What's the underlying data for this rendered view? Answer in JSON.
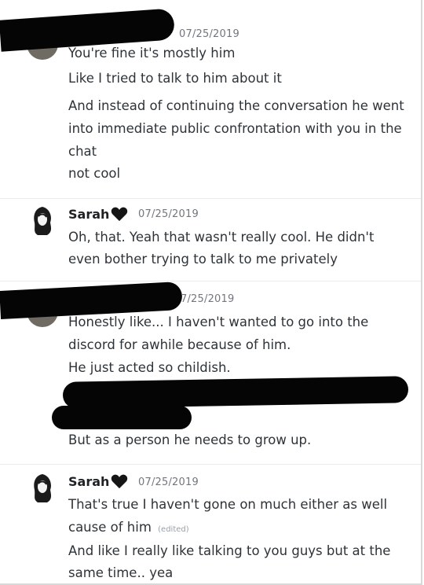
{
  "messages": [
    {
      "user": "",
      "timestamp": "07/25/2019",
      "lines": [
        "You're fine it's mostly him",
        "Like I tried to talk to him about it",
        "And instead of continuing the conversation he went into immediate public confrontation with you in the chat",
        "not cool"
      ]
    },
    {
      "user": "Sarah",
      "timestamp": "07/25/2019",
      "lines": [
        "Oh, that. Yeah that wasn't really cool. He didn't even bother trying to talk to me privately"
      ]
    },
    {
      "user": "",
      "timestamp": "7/25/2019",
      "lines": [
        "Honestly like... I haven't wanted to go into the discord for awhile because of him.",
        "He just acted so childish.",
        "But as a person he needs to grow up."
      ]
    },
    {
      "user": "Sarah",
      "timestamp": "07/25/2019",
      "lines": [
        "That's true I haven't gone on much either as well cause of him",
        "And like I really like talking to you guys but at the same time.. yea"
      ],
      "edited_label": "(edited)"
    }
  ],
  "icons": {
    "user_badge": "black-heart-icon"
  },
  "colors": {
    "redaction": "#050505",
    "timestamp": "#72767d",
    "text": "#2e3338"
  }
}
